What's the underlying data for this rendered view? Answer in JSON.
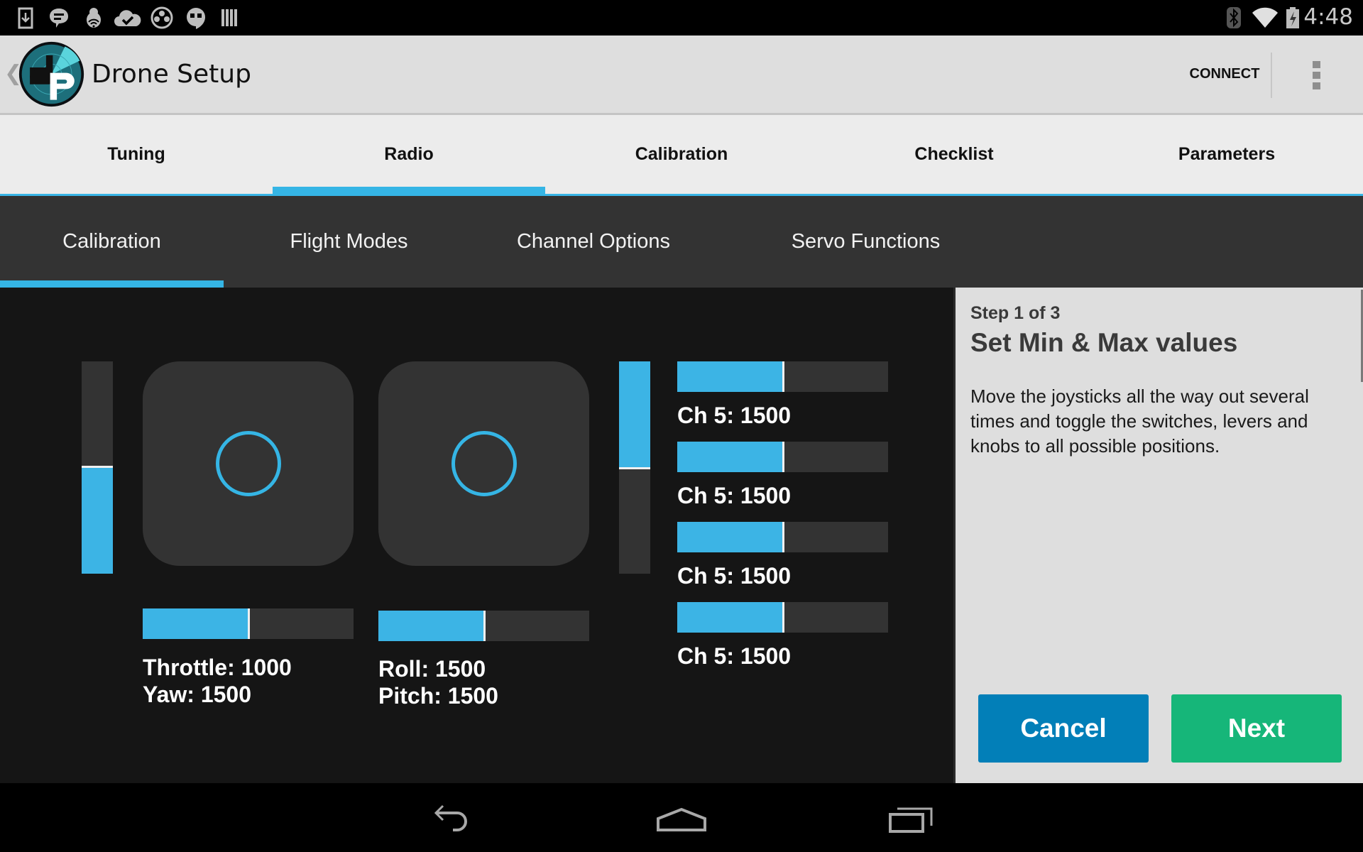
{
  "status_bar": {
    "notification_icons": [
      "download-icon",
      "chat-icon",
      "debug-bug-icon",
      "cloud-check-icon",
      "circles-app-icon",
      "hangouts-icon",
      "barcode-icon"
    ],
    "system_icons": [
      "bluetooth-icon",
      "wifi-icon",
      "battery-charging-icon"
    ],
    "time": "4:48"
  },
  "action_bar": {
    "title": "Drone Setup",
    "connect_label": "CONNECT"
  },
  "main_tabs": [
    {
      "label": "Tuning",
      "selected": false
    },
    {
      "label": "Radio",
      "selected": true
    },
    {
      "label": "Calibration",
      "selected": false
    },
    {
      "label": "Checklist",
      "selected": false
    },
    {
      "label": "Parameters",
      "selected": false
    }
  ],
  "sub_tabs": [
    {
      "label": "Calibration",
      "selected": true
    },
    {
      "label": "Flight Modes",
      "selected": false
    },
    {
      "label": "Channel Options",
      "selected": false
    },
    {
      "label": "Servo Functions",
      "selected": false
    }
  ],
  "radio": {
    "left_vertical_bar": {
      "fill_fraction": 0.5,
      "fill_from": "bottom"
    },
    "right_vertical_bar": {
      "fill_fraction": 0.5,
      "fill_from": "top"
    },
    "left_stick": {
      "x": 0.5,
      "y": 0.5
    },
    "right_stick": {
      "x": 0.5,
      "y": 0.5
    },
    "left_hbar": {
      "fill_fraction": 0.5
    },
    "right_hbar": {
      "fill_fraction": 0.5
    },
    "left_labels": [
      "Throttle: 1000",
      "Yaw: 1500"
    ],
    "right_labels": [
      "Roll: 1500",
      "Pitch: 1500"
    ],
    "channels": [
      {
        "label": "Ch 5: 1500",
        "fill_fraction": 0.5
      },
      {
        "label": "Ch 5: 1500",
        "fill_fraction": 0.5
      },
      {
        "label": "Ch 5: 1500",
        "fill_fraction": 0.5
      },
      {
        "label": "Ch 5: 1500",
        "fill_fraction": 0.5
      }
    ]
  },
  "wizard": {
    "step": "Step 1 of 3",
    "title": "Set Min & Max values",
    "body": "Move the joysticks all the way out several times and toggle the switches, levers and knobs to all possible positions.",
    "cancel_label": "Cancel",
    "next_label": "Next"
  },
  "colors": {
    "accent": "#35b5e5",
    "cancel": "#027fb8",
    "next": "#16b679"
  }
}
